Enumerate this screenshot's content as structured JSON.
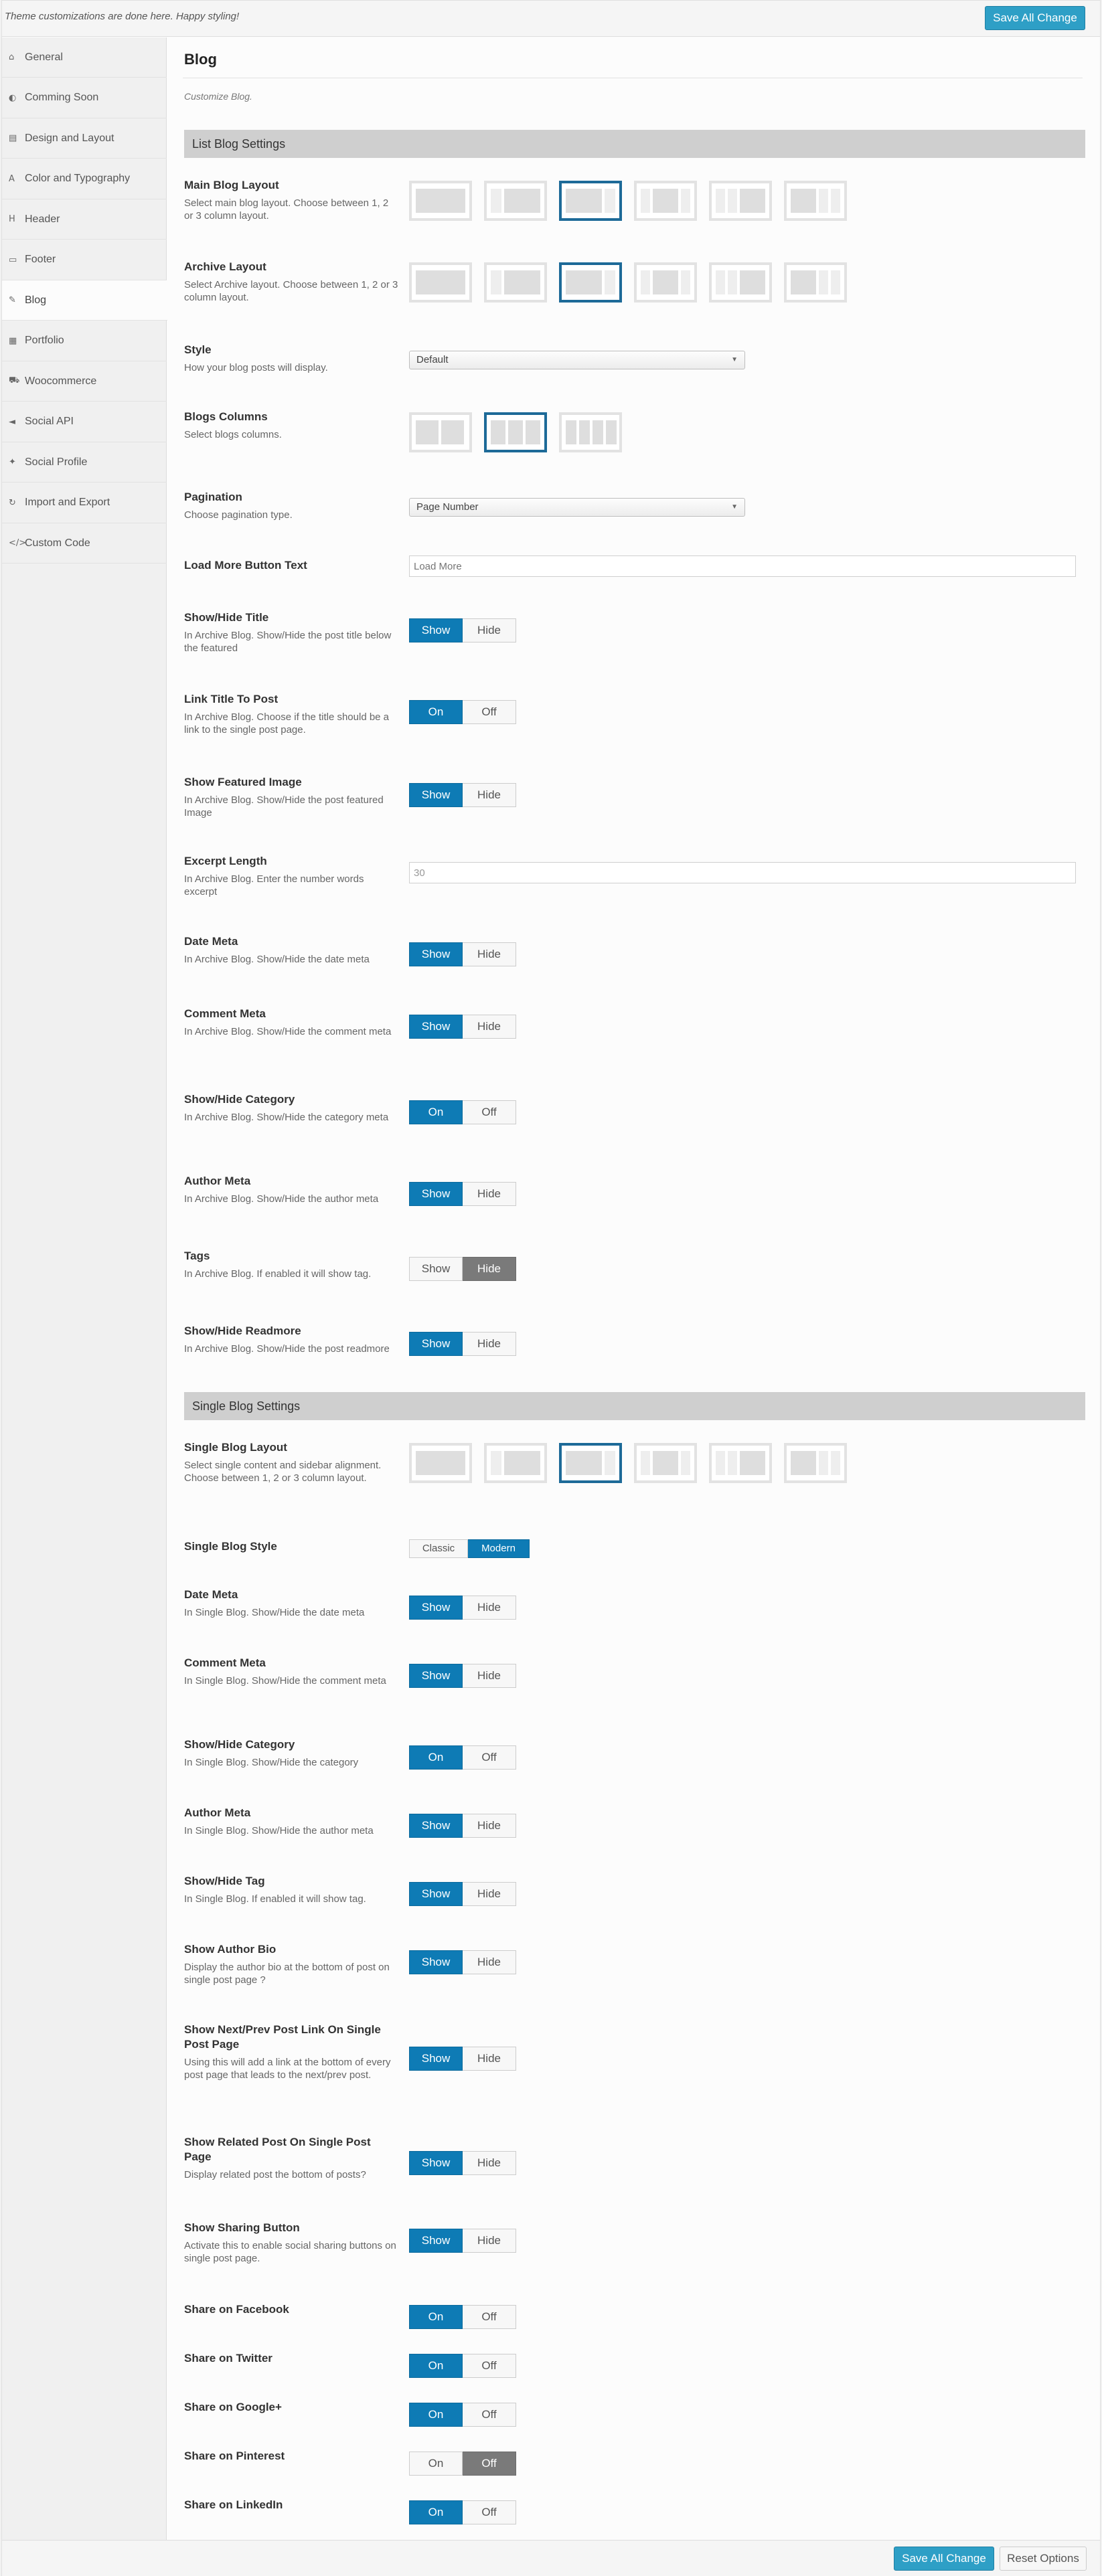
{
  "topbar": {
    "note": "Theme customizations are done here. Happy styling!",
    "save_label": "Save All Change"
  },
  "footer": {
    "save_label": "Save All Change",
    "reset_label": "Reset Options"
  },
  "sidebar": {
    "items": [
      {
        "label": "General",
        "icon": "home-icon",
        "glyph": "⌂"
      },
      {
        "label": "Comming Soon",
        "icon": "half-circle-icon",
        "glyph": "◐"
      },
      {
        "label": "Design and Layout",
        "icon": "layout-icon",
        "glyph": "▤"
      },
      {
        "label": "Color and Typography",
        "icon": "font-icon",
        "glyph": "A"
      },
      {
        "label": "Header",
        "icon": "header-icon",
        "glyph": "H"
      },
      {
        "label": "Footer",
        "icon": "footer-icon",
        "glyph": "▭"
      },
      {
        "label": "Blog",
        "icon": "pencil-icon",
        "glyph": "✎"
      },
      {
        "label": "Portfolio",
        "icon": "grid-icon",
        "glyph": "▦"
      },
      {
        "label": "Woocommerce",
        "icon": "cart-icon",
        "glyph": "⛟"
      },
      {
        "label": "Social API",
        "icon": "share-icon",
        "glyph": "◄"
      },
      {
        "label": "Social Profile",
        "icon": "twitter-icon",
        "glyph": "✦"
      },
      {
        "label": "Import and Export",
        "icon": "refresh-icon",
        "glyph": "↻"
      },
      {
        "label": "Custom Code",
        "icon": "code-icon",
        "glyph": "</>"
      }
    ],
    "active": "Blog"
  },
  "main": {
    "title": "Blog",
    "subtitle": "Customize Blog."
  },
  "list_section": {
    "heading": "List Blog Settings",
    "main_layout": {
      "title": "Main Blog Layout",
      "desc": "Select main blog layout. Choose between 1, 2 or 3 column layout.",
      "selected_index": 2
    },
    "archive_layout": {
      "title": "Archive Layout",
      "desc": "Select Archive layout. Choose between 1, 2 or 3 column layout.",
      "selected_index": 2
    },
    "style": {
      "title": "Style",
      "desc": "How your blog posts will display.",
      "value": "Default"
    },
    "columns": {
      "title": "Blogs Columns",
      "desc": "Select blogs columns.",
      "selected_index": 1
    },
    "pagination": {
      "title": "Pagination",
      "desc": "Choose pagination type.",
      "value": "Page Number"
    },
    "load_more": {
      "title": "Load More Button Text",
      "placeholder": "Load More"
    },
    "title_toggle": {
      "title": "Show/Hide Title",
      "desc": "In Archive Blog. Show/Hide the post title below the featured",
      "opt1": "Show",
      "opt2": "Hide",
      "selected": 1
    },
    "link_title": {
      "title": "Link Title To Post",
      "desc": "In Archive Blog. Choose if the title should be a link to the single post page.",
      "opt1": "On",
      "opt2": "Off",
      "selected": 1
    },
    "featured_image": {
      "title": "Show Featured Image",
      "desc": "In Archive Blog. Show/Hide the post featured Image",
      "opt1": "Show",
      "opt2": "Hide",
      "selected": 1
    },
    "excerpt": {
      "title": "Excerpt Length",
      "desc": "In Archive Blog. Enter the number words excerpt",
      "value": "30"
    },
    "date_meta": {
      "title": "Date Meta",
      "desc": "In Archive Blog. Show/Hide the date meta",
      "opt1": "Show",
      "opt2": "Hide",
      "selected": 1
    },
    "comment_meta": {
      "title": "Comment Meta",
      "desc": "In Archive Blog. Show/Hide the comment meta",
      "opt1": "Show",
      "opt2": "Hide",
      "selected": 1
    },
    "category": {
      "title": "Show/Hide Category",
      "desc": "In Archive Blog. Show/Hide the category meta",
      "opt1": "On",
      "opt2": "Off",
      "selected": 1
    },
    "author_meta": {
      "title": "Author Meta",
      "desc": "In Archive Blog. Show/Hide the author meta",
      "opt1": "Show",
      "opt2": "Hide",
      "selected": 1
    },
    "tags": {
      "title": "Tags",
      "desc": "In Archive Blog. If enabled it will show tag.",
      "opt1": "Show",
      "opt2": "Hide",
      "selected": 2
    },
    "readmore": {
      "title": "Show/Hide Readmore",
      "desc": "In Archive Blog. Show/Hide the post readmore",
      "opt1": "Show",
      "opt2": "Hide",
      "selected": 1
    }
  },
  "single_section": {
    "heading": "Single Blog Settings",
    "layout": {
      "title": "Single Blog Layout",
      "desc": "Select single content and sidebar alignment. Choose between 1, 2 or 3 column layout.",
      "selected_index": 2
    },
    "style": {
      "title": "Single Blog Style",
      "opt1": "Classic",
      "opt2": "Modern",
      "selected": 2
    },
    "date_meta": {
      "title": "Date Meta",
      "desc": "In Single Blog. Show/Hide the date meta",
      "opt1": "Show",
      "opt2": "Hide",
      "selected": 1
    },
    "comment_meta": {
      "title": "Comment Meta",
      "desc": "In Single Blog. Show/Hide the comment meta",
      "opt1": "Show",
      "opt2": "Hide",
      "selected": 1
    },
    "category": {
      "title": "Show/Hide Category",
      "desc": "In Single Blog. Show/Hide the category",
      "opt1": "On",
      "opt2": "Off",
      "selected": 1
    },
    "author_meta": {
      "title": "Author Meta",
      "desc": "In Single Blog. Show/Hide the author meta",
      "opt1": "Show",
      "opt2": "Hide",
      "selected": 1
    },
    "tag": {
      "title": "Show/Hide Tag",
      "desc": "In Single Blog. If enabled it will show tag.",
      "opt1": "Show",
      "opt2": "Hide",
      "selected": 1
    },
    "author_bio": {
      "title": "Show Author Bio",
      "desc": "Display the author bio at the bottom of post on single post page ?",
      "opt1": "Show",
      "opt2": "Hide",
      "selected": 1
    },
    "next_prev": {
      "title": "Show Next/Prev Post Link On Single Post Page",
      "desc": "Using this will add a link at the bottom of every post page that leads to the next/prev post.",
      "opt1": "Show",
      "opt2": "Hide",
      "selected": 1
    },
    "related": {
      "title": "Show Related Post On Single Post Page",
      "desc": "Display related post the bottom of posts?",
      "opt1": "Show",
      "opt2": "Hide",
      "selected": 1
    },
    "sharing": {
      "title": "Show Sharing Button",
      "desc": "Activate this to enable social sharing buttons on single post page.",
      "opt1": "Show",
      "opt2": "Hide",
      "selected": 1
    },
    "facebook": {
      "title": "Share on Facebook",
      "opt1": "On",
      "opt2": "Off",
      "selected": 1
    },
    "twitter": {
      "title": "Share on Twitter",
      "opt1": "On",
      "opt2": "Off",
      "selected": 1
    },
    "googleplus": {
      "title": "Share on Google+",
      "opt1": "On",
      "opt2": "Off",
      "selected": 1
    },
    "pinterest": {
      "title": "Share on Pinterest",
      "opt1": "On",
      "opt2": "Off",
      "selected": 2
    },
    "linkedin": {
      "title": "Share on LinkedIn",
      "opt1": "On",
      "opt2": "Off",
      "selected": 1
    }
  },
  "colors": {
    "primary": "#0e7bb5",
    "button": "#2e9fc6",
    "selected_border": "#1d6a98",
    "section_bar": "#cfcfcf"
  }
}
